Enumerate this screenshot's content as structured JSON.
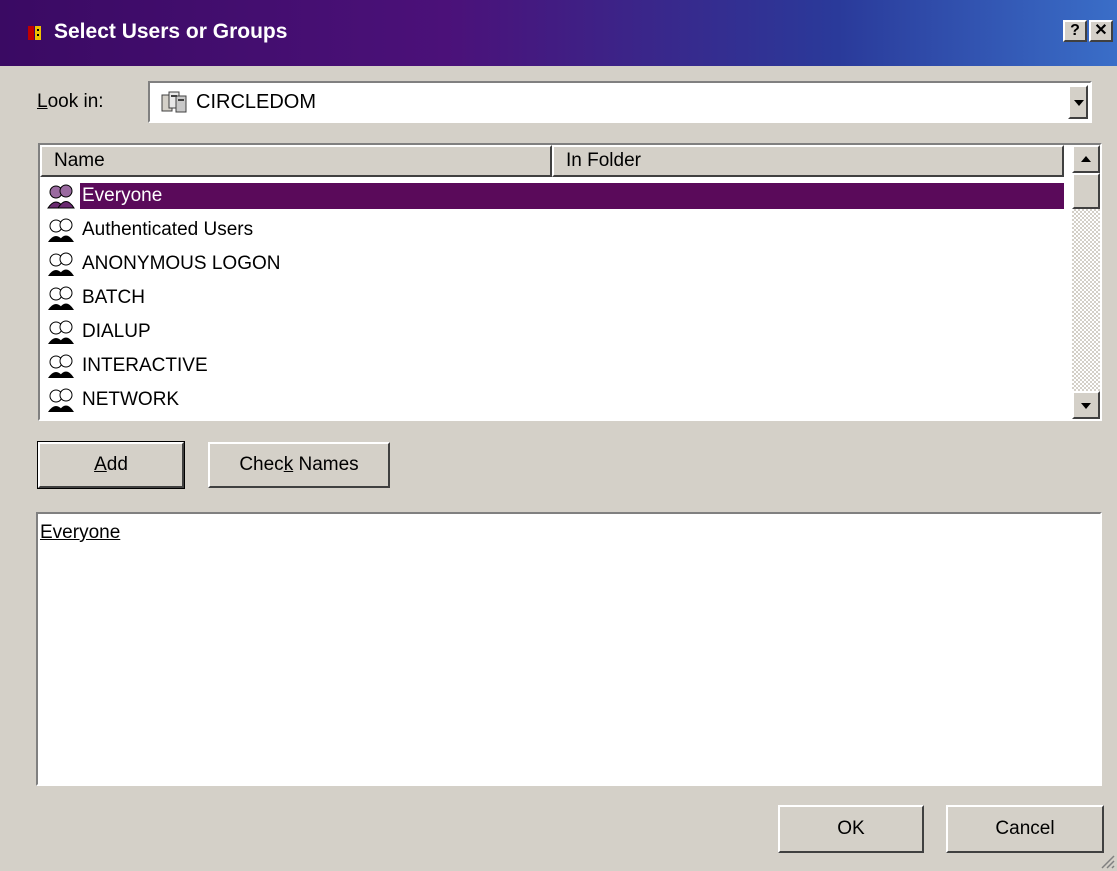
{
  "window": {
    "title": "Select Users or Groups",
    "help_label": "?",
    "close_label": "✕"
  },
  "look_in": {
    "label_accel": "L",
    "label_rest": "ook in:",
    "value": "CIRCLEDOM"
  },
  "list": {
    "columns": [
      "Name",
      "In Folder"
    ],
    "rows": [
      {
        "name": "Everyone",
        "folder": "",
        "selected": true
      },
      {
        "name": "Authenticated Users",
        "folder": ""
      },
      {
        "name": "ANONYMOUS LOGON",
        "folder": ""
      },
      {
        "name": "BATCH",
        "folder": ""
      },
      {
        "name": "DIALUP",
        "folder": ""
      },
      {
        "name": "INTERACTIVE",
        "folder": ""
      },
      {
        "name": "NETWORK",
        "folder": ""
      }
    ]
  },
  "buttons": {
    "add_accel": "A",
    "add_rest": "dd",
    "check_pre": "Chec",
    "check_accel": "k",
    "check_post": " Names",
    "ok": "OK",
    "cancel": "Cancel"
  },
  "selected_names": "Everyone",
  "colors": {
    "selection": "#5a0a5a",
    "title_start": "#3a0a63",
    "title_end": "#3a6ec8",
    "face": "#d4d0c8"
  },
  "icons": {
    "app": "window-icon",
    "domain": "domain-icon",
    "user_group": "user-group-icon"
  }
}
